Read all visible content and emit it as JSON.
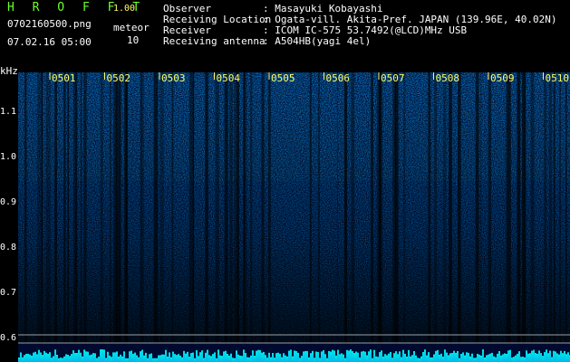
{
  "header": {
    "app_title": "H R O F F T",
    "version": "1.00",
    "filename": "0702160500.png",
    "datetime": "07.02.16 05:00",
    "meteor_label": "meteor",
    "meteor_count": "10"
  },
  "info": [
    {
      "label": "Observer",
      "value": "Masayuki Kobayashi"
    },
    {
      "label": "Receiving Location",
      "value": "Ogata-vill. Akita-Pref. JAPAN (139.96E, 40.02N)"
    },
    {
      "label": "Receiver",
      "value": "ICOM IC-575 53.7492(@LCD)MHz USB"
    },
    {
      "label": "Receiving antenna",
      "value": "A504HB(yagi 4el)"
    }
  ],
  "axis": {
    "unit": "kHz",
    "ticks": [
      "1.1",
      "1.0",
      "0.9",
      "0.8",
      "0.7",
      "0.6"
    ]
  },
  "time_marks": [
    "0501",
    "0502",
    "0503",
    "0504",
    "0505",
    "0506",
    "0507",
    "0508",
    "0509",
    "0510"
  ],
  "colors": {
    "background": "#000000",
    "title_green": "#6cff2c",
    "marker_yellow": "#ffff66",
    "spectrum_low": "#001060",
    "spectrum_high": "#00ffff"
  }
}
